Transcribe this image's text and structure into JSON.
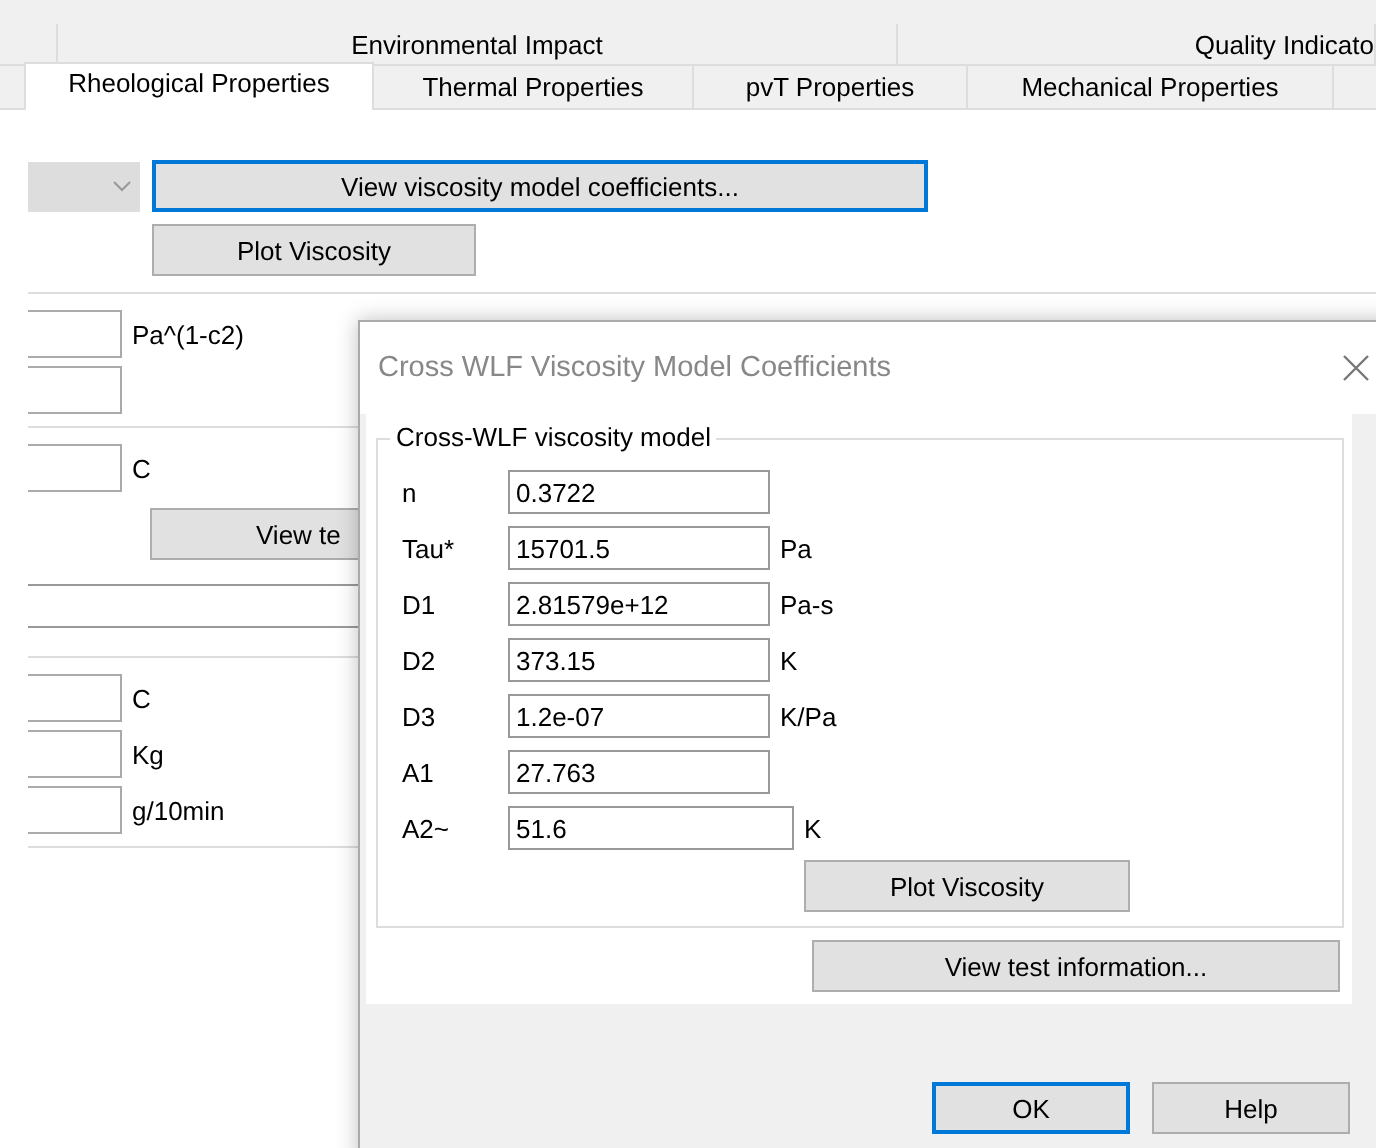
{
  "tab_rows": [
    [
      {
        "label": "Environmental Impact",
        "selected": false
      },
      {
        "label": "Quality Indicato",
        "selected": false
      }
    ],
    [
      {
        "label": "Rheological Properties",
        "selected": true
      },
      {
        "label": "Thermal Properties",
        "selected": false
      },
      {
        "label": "pvT Properties",
        "selected": false
      },
      {
        "label": "Mechanical Properties",
        "selected": false
      }
    ]
  ],
  "viscosity": {
    "view_button": "View viscosity model coefficients...",
    "plot_button": "Plot Viscosity"
  },
  "sections": [
    {
      "fields": [
        {
          "kind": "unit",
          "unit": "Pa^(1-c2)"
        },
        {
          "kind": "plain"
        }
      ]
    },
    {
      "fields": [
        {
          "kind": "unit",
          "unit": "C"
        }
      ],
      "button": "View te"
    },
    {
      "fields": [
        {
          "kind": "unit",
          "unit": "C"
        },
        {
          "kind": "unit",
          "unit": "Kg"
        },
        {
          "kind": "unit",
          "unit": "g/10min"
        }
      ]
    }
  ],
  "dialog": {
    "title": "Cross WLF Viscosity Model Coefficients",
    "group_label": "Cross-WLF viscosity model",
    "params": [
      {
        "label": "n",
        "value": "0.3722"
      },
      {
        "label": "Tau*",
        "value": "15701.5",
        "unit": "Pa"
      },
      {
        "label": "D1",
        "value": "2.81579e+12",
        "unit": "Pa-s"
      },
      {
        "label": "D2",
        "value": "373.15",
        "unit": "K"
      },
      {
        "label": "D3",
        "value": "1.2e-07",
        "unit": "K/Pa"
      },
      {
        "label": "A1",
        "value": "27.763"
      },
      {
        "label": "A2~",
        "value": "51.6",
        "unit": "K",
        "kind": "wide"
      }
    ],
    "plot_button": "Plot Viscosity",
    "view_test_button": "View test information...",
    "ok_button": "OK",
    "help_button": "Help"
  }
}
